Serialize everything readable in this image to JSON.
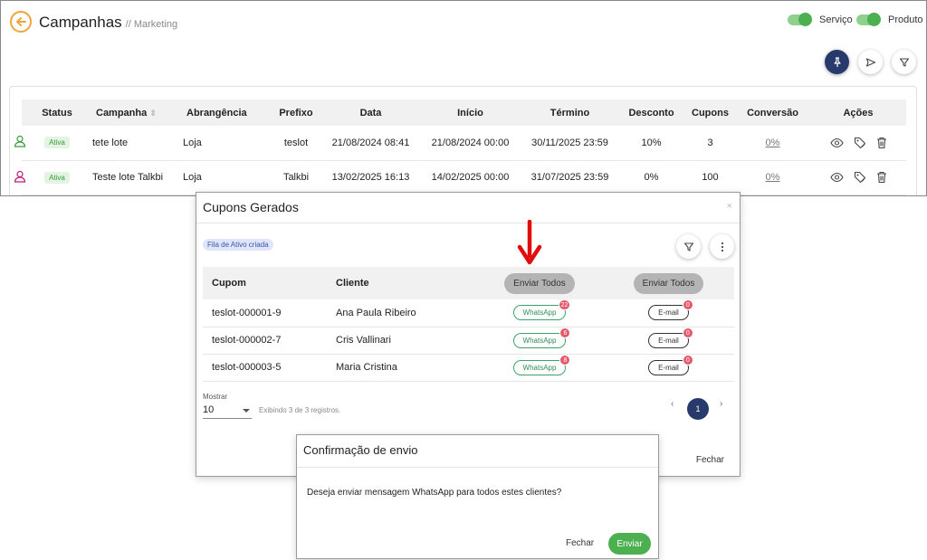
{
  "header": {
    "title": "Campanhas",
    "breadcrumb": "// Marketing"
  },
  "toggles": [
    {
      "label": "Serviço",
      "on": true
    },
    {
      "label": "Produto",
      "on": true
    }
  ],
  "icons": {
    "back": "arrow-left-icon",
    "pin": "pin-icon",
    "send": "send-icon",
    "filter": "filter-icon",
    "more": "more-vertical-icon",
    "view": "eye-icon",
    "tag": "tag-icon",
    "delete": "trash-icon",
    "user": "user-icon"
  },
  "colors": {
    "accent_orange": "#f0a43a",
    "primary_dark": "#283a6b",
    "success": "#4caf50",
    "badge_red": "#e35b6b",
    "whatsapp_green": "#3aa36a"
  },
  "campaigns_table": {
    "columns": [
      "Status",
      "Campanha",
      "Abrangência",
      "Prefixo",
      "Data",
      "Início",
      "Término",
      "Desconto",
      "Cupons",
      "Conversão",
      "Ações"
    ],
    "rows": [
      {
        "user_color": "#3a9a3a",
        "status": "Ativa",
        "campanha": "tete lote",
        "abrangencia": "Loja",
        "prefixo": "teslot",
        "data": "21/08/2024 08:41",
        "inicio": "21/08/2024 00:00",
        "termino": "30/11/2025 23:59",
        "desconto": "10%",
        "cupons": "3",
        "conversao": "0%"
      },
      {
        "user_color": "#c2187a",
        "status": "Ativa",
        "campanha": "Teste lote Talkbi",
        "abrangencia": "Loja",
        "prefixo": "Talkbi",
        "data": "13/02/2025 16:13",
        "inicio": "14/02/2025 00:00",
        "termino": "31/07/2025 23:59",
        "desconto": "0%",
        "cupons": "100",
        "conversao": "0%"
      }
    ]
  },
  "coupons_modal": {
    "title": "Cupons Gerados",
    "close_glyph": "×",
    "queue_badge": "Fila de Ativo criada",
    "columns": {
      "cupom": "Cupom",
      "cliente": "Cliente",
      "send_all_whatsapp": "Enviar Todos",
      "send_all_email": "Enviar Todos"
    },
    "rows": [
      {
        "cupom": "teslot-000001-9",
        "cliente": "Ana Paula Ribeiro",
        "whatsapp_label": "WhatsApp",
        "whatsapp_count": "22",
        "email_label": "E-mail",
        "email_count": "0"
      },
      {
        "cupom": "teslot-000002-7",
        "cliente": "Cris Vallinari",
        "whatsapp_label": "WhatsApp",
        "whatsapp_count": "6",
        "email_label": "E-mail",
        "email_count": "0"
      },
      {
        "cupom": "teslot-000003-5",
        "cliente": "Maria Cristina",
        "whatsapp_label": "WhatsApp",
        "whatsapp_count": "8",
        "email_label": "E-mail",
        "email_count": "0"
      }
    ],
    "show_label": "Mostrar",
    "page_size": "10",
    "showing_text": "Exibindo 3 de 3 registros.",
    "pager": {
      "prev": "‹",
      "current": "1",
      "next": "›"
    },
    "close_label": "Fechar"
  },
  "confirm_modal": {
    "title": "Confirmação de envio",
    "message": "Deseja enviar mensagem WhatsApp para todos estes clientes?",
    "close_label": "Fechar",
    "send_label": "Enviar"
  }
}
